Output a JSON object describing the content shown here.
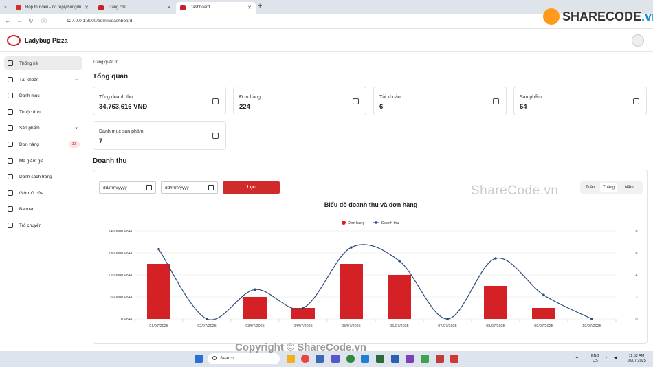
{
  "browser": {
    "tabs": [
      {
        "label": "Hộp thư đến - no.reply.hungdu",
        "icon_color": "#d93025"
      },
      {
        "label": "Trang chủ",
        "icon_color": "#c8202a"
      },
      {
        "label": "Dashboard",
        "icon_color": "#c8202a"
      }
    ],
    "url": "127.0.0.1:8000/admin/dashboard"
  },
  "watermark": {
    "logo_text_a": "SHARECODE",
    "logo_text_b": ".vn",
    "center": "ShareCode.vn",
    "footer": "Copyright © ShareCode.vn"
  },
  "app": {
    "brand": "Ladybug Pizza"
  },
  "sidebar": {
    "items": [
      {
        "label": "Thống kê",
        "active": true,
        "icon": "chart-pie-icon"
      },
      {
        "label": "Tài khoản",
        "chevron": true,
        "icon": "user-icon"
      },
      {
        "label": "Danh mục",
        "icon": "grid-icon"
      },
      {
        "label": "Thuộc tính",
        "icon": "sort-icon"
      },
      {
        "label": "Sản phẩm",
        "chevron": true,
        "icon": "triangle-icon"
      },
      {
        "label": "Đơn hàng",
        "badge": "33",
        "icon": "box-icon"
      },
      {
        "label": "Mã giảm giá",
        "icon": "tag-icon"
      },
      {
        "label": "Danh sách trang",
        "icon": "pages-icon"
      },
      {
        "label": "Giờ mở cửa",
        "icon": "clock-icon"
      },
      {
        "label": "Banner",
        "icon": "image-icon"
      },
      {
        "label": "Trò chuyện",
        "icon": "chat-icon"
      }
    ]
  },
  "main": {
    "breadcrumb": "Trang quản trị",
    "overview_title": "Tổng quan",
    "cards": [
      {
        "label": "Tổng doanh thu",
        "value": "34,763,616 VNĐ",
        "icon": "wallet-icon"
      },
      {
        "label": "Đơn hàng",
        "value": "224",
        "icon": "box-icon"
      },
      {
        "label": "Tài khoản",
        "value": "6",
        "icon": "user-icon"
      },
      {
        "label": "Sản phẩm",
        "value": "64",
        "icon": "triangle-icon"
      },
      {
        "label": "Danh mục sản phẩm",
        "value": "7",
        "icon": "grid-icon"
      }
    ],
    "revenue_title": "Doanh thu",
    "date_from_placeholder": "dd/mm/yyyy",
    "date_to_placeholder": "dd/mm/yyyy",
    "filter_label": "Lọc",
    "periods": [
      "Tuần",
      "Tháng",
      "Năm"
    ],
    "selected_period": "Tháng"
  },
  "chart_data": {
    "type": "bar",
    "title": "Biểu đồ doanh thu và đơn hàng",
    "categories": [
      "01/07/2025",
      "02/07/2025",
      "03/07/2025",
      "04/07/2025",
      "05/07/2025",
      "06/07/2025",
      "07/07/2025",
      "08/07/2025",
      "09/07/2025",
      "10/07/2025"
    ],
    "series": [
      {
        "name": "Đơn hàng",
        "type": "bar",
        "axis": "right",
        "color": "#d42126",
        "values": [
          5,
          0,
          2,
          1,
          5,
          4,
          0,
          3,
          1,
          0
        ]
      },
      {
        "name": "Doanh thu",
        "type": "line",
        "axis": "left",
        "color": "#2c4a7a",
        "values": [
          1900000,
          0,
          800000,
          300000,
          1950000,
          1580000,
          0,
          1650000,
          650000,
          0
        ]
      }
    ],
    "y_left": {
      "ticks": [
        "0 VNĐ",
        "600000 VNĐ",
        "1200000 VNĐ",
        "1800000 VNĐ",
        "2400000 VNĐ"
      ],
      "lim": [
        0,
        2400000
      ]
    },
    "y_right": {
      "ticks": [
        "0",
        "2",
        "4",
        "6",
        "8"
      ],
      "lim": [
        0,
        8
      ]
    },
    "legend": "top-center",
    "grid": true
  },
  "taskbar": {
    "search": "Search",
    "lang": "ENG",
    "region": "US",
    "time": "11:52 AM",
    "date": "10/07/2025"
  }
}
